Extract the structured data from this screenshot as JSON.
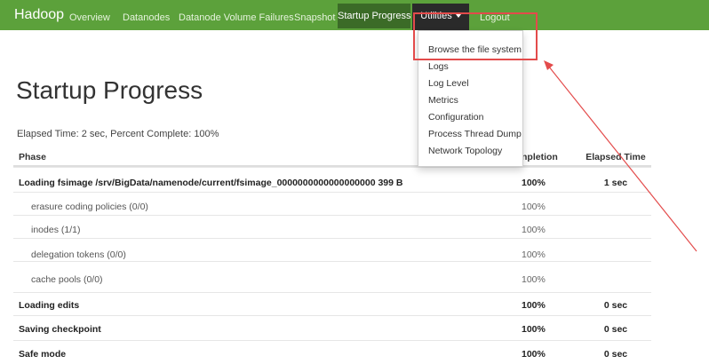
{
  "navbar": {
    "brand": "Hadoop",
    "items": [
      {
        "label": "Overview"
      },
      {
        "label": "Datanodes"
      },
      {
        "label": "Datanode Volume Failures"
      },
      {
        "label": "Snapshot"
      },
      {
        "label": "Startup Progress"
      },
      {
        "label": "Utilities"
      },
      {
        "label": "Logout"
      }
    ],
    "active_item": "Startup Progress",
    "open_item": "Utilities"
  },
  "utilities_menu": {
    "items": [
      {
        "label": "Browse the file system"
      },
      {
        "label": "Logs"
      },
      {
        "label": "Log Level"
      },
      {
        "label": "Metrics"
      },
      {
        "label": "Configuration"
      },
      {
        "label": "Process Thread Dump"
      },
      {
        "label": "Network Topology"
      }
    ]
  },
  "page": {
    "title": "Startup Progress",
    "elapsed_text": "Elapsed Time: 2 sec, Percent Complete: 100%"
  },
  "table": {
    "headers": {
      "phase": "Phase",
      "completion": "npletion",
      "elapsed": "Elapsed Time"
    },
    "rows": [
      {
        "phase": "Loading fsimage /srv/BigData/namenode/current/fsimage_0000000000000000000 399 B",
        "completion": "100%",
        "elapsed": "1 sec"
      },
      {
        "phase": "erasure coding policies (0/0)",
        "completion": "100%",
        "elapsed": ""
      },
      {
        "phase": "inodes (1/1)",
        "completion": "100%",
        "elapsed": ""
      },
      {
        "phase": "delegation tokens (0/0)",
        "completion": "100%",
        "elapsed": ""
      },
      {
        "phase": "cache pools (0/0)",
        "completion": "100%",
        "elapsed": ""
      },
      {
        "phase": "Loading edits",
        "completion": "100%",
        "elapsed": "0 sec"
      },
      {
        "phase": "Saving checkpoint",
        "completion": "100%",
        "elapsed": "0 sec"
      },
      {
        "phase": "Safe mode",
        "completion": "100%",
        "elapsed": "0 sec"
      }
    ]
  },
  "colors": {
    "navbar": "#5ca13b",
    "navbar_active": "#3b6b27",
    "navbar_open": "#2a2a2a",
    "annotation": "#e34b4b"
  }
}
